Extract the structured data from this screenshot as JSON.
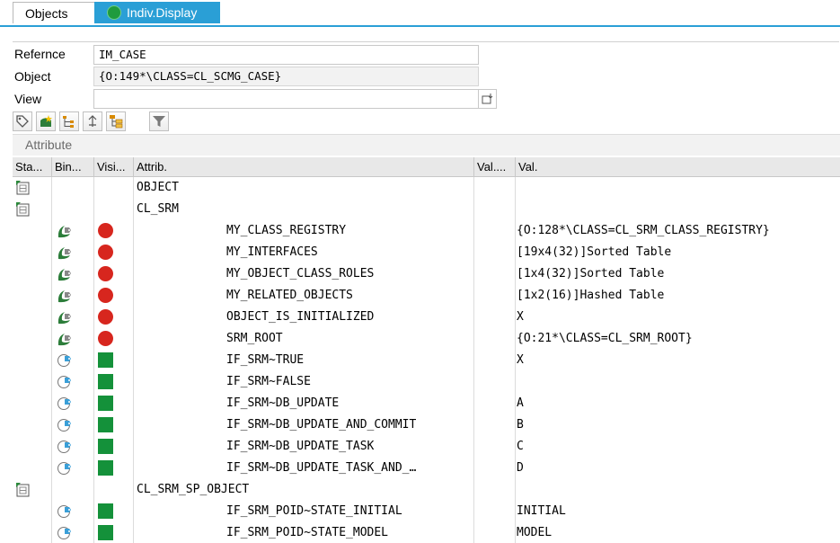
{
  "tabs": {
    "objects": "Objects",
    "indiv_display": "Indiv.Display"
  },
  "fields": {
    "reference_label": "Refernce",
    "reference_value": "IM_CASE",
    "object_label": "Object",
    "object_value": "{O:149*\\CLASS=CL_SCMG_CASE}",
    "view_label": "View",
    "view_value": ""
  },
  "toolbar": [
    "tag-icon",
    "new-attribute-icon",
    "hierarchy-icon",
    "up-icon",
    "structure-icon",
    "filter-icon"
  ],
  "attribute_title": "Attribute",
  "columns": [
    "Sta...",
    "Bin...",
    "Visi...",
    "Attrib.",
    "Val....",
    "Val."
  ],
  "rows": [
    {
      "kind": "class",
      "name": "OBJECT",
      "value": ""
    },
    {
      "kind": "class",
      "name": "CL_SRM",
      "value": ""
    },
    {
      "kind": "attr",
      "binding": "instance",
      "visibility": "private",
      "name": "MY_CLASS_REGISTRY",
      "value": "{O:128*\\CLASS=CL_SRM_CLASS_REGISTRY}"
    },
    {
      "kind": "attr",
      "binding": "instance",
      "visibility": "private",
      "name": "MY_INTERFACES",
      "value": "[19x4(32)]Sorted Table"
    },
    {
      "kind": "attr",
      "binding": "instance",
      "visibility": "private",
      "name": "MY_OBJECT_CLASS_ROLES",
      "value": "[1x4(32)]Sorted Table"
    },
    {
      "kind": "attr",
      "binding": "instance",
      "visibility": "private",
      "name": "MY_RELATED_OBJECTS",
      "value": "[1x2(16)]Hashed Table"
    },
    {
      "kind": "attr",
      "binding": "instance",
      "visibility": "private",
      "name": "OBJECT_IS_INITIALIZED",
      "value": "X"
    },
    {
      "kind": "attr",
      "binding": "instance",
      "visibility": "private",
      "name": "SRM_ROOT",
      "value": "{O:21*\\CLASS=CL_SRM_ROOT}"
    },
    {
      "kind": "attr",
      "binding": "static",
      "visibility": "public",
      "name": "IF_SRM~TRUE",
      "value": "X"
    },
    {
      "kind": "attr",
      "binding": "static",
      "visibility": "public",
      "name": "IF_SRM~FALSE",
      "value": ""
    },
    {
      "kind": "attr",
      "binding": "static",
      "visibility": "public",
      "name": "IF_SRM~DB_UPDATE",
      "value": "A"
    },
    {
      "kind": "attr",
      "binding": "static",
      "visibility": "public",
      "name": "IF_SRM~DB_UPDATE_AND_COMMIT",
      "value": "B"
    },
    {
      "kind": "attr",
      "binding": "static",
      "visibility": "public",
      "name": "IF_SRM~DB_UPDATE_TASK",
      "value": "C"
    },
    {
      "kind": "attr",
      "binding": "static",
      "visibility": "public",
      "name": "IF_SRM~DB_UPDATE_TASK_AND_…",
      "value": "D"
    },
    {
      "kind": "class",
      "name": "CL_SRM_SP_OBJECT",
      "value": ""
    },
    {
      "kind": "attr",
      "binding": "static",
      "visibility": "public",
      "name": "IF_SRM_POID~STATE_INITIAL",
      "value": "INITIAL"
    },
    {
      "kind": "attr",
      "binding": "static",
      "visibility": "public",
      "name": "IF_SRM_POID~STATE_MODEL",
      "value": "MODEL"
    }
  ],
  "colors": {
    "accent": "#2a9fd6",
    "private": "#d7261e",
    "public": "#14913a"
  }
}
